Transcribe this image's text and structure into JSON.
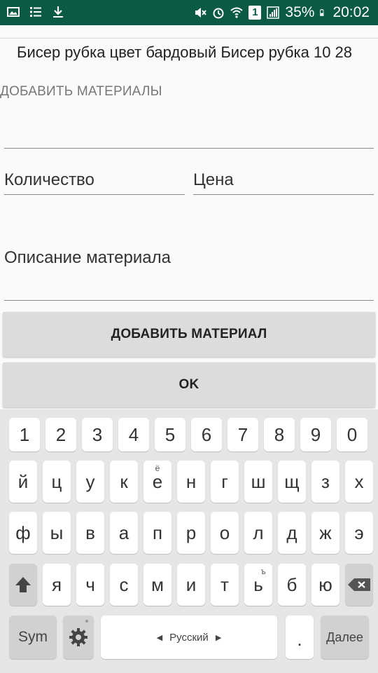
{
  "status_bar": {
    "battery": "35%",
    "time": "20:02",
    "sim": "1",
    "icons": [
      "image-icon",
      "list-icon",
      "download-icon",
      "mute-icon",
      "alarm-icon",
      "wifi-icon",
      "sim-icon",
      "signal-icon",
      "battery-icon"
    ]
  },
  "content": {
    "title": "Бисер рубка цвет бардовый Бисер рубка 10 28",
    "section_label": "ДОБАВИТЬ МАТЕРИАЛЫ",
    "fields": {
      "name": "",
      "quantity": "Количество",
      "price": "Цена",
      "description": "Описание материала"
    },
    "buttons": {
      "add": "ДОБАВИТЬ МАТЕРИАЛ",
      "ok": "OK"
    }
  },
  "keyboard": {
    "numbers": [
      "1",
      "2",
      "3",
      "4",
      "5",
      "6",
      "7",
      "8",
      "9",
      "0"
    ],
    "row1": [
      "й",
      "ц",
      "у",
      "к",
      "е",
      "н",
      "г",
      "ш",
      "щ",
      "з",
      "х"
    ],
    "row1_superscripts": {
      "е": "ё"
    },
    "row2": [
      "ф",
      "ы",
      "в",
      "а",
      "п",
      "р",
      "о",
      "л",
      "д",
      "ж",
      "э"
    ],
    "row3": [
      "я",
      "ч",
      "с",
      "м",
      "и",
      "т",
      "ь",
      "б",
      "ю"
    ],
    "row3_superscripts": {
      "ь": "ъ"
    },
    "sym": "Sym",
    "space": "Русский",
    "period": ".",
    "done": "Далее"
  }
}
